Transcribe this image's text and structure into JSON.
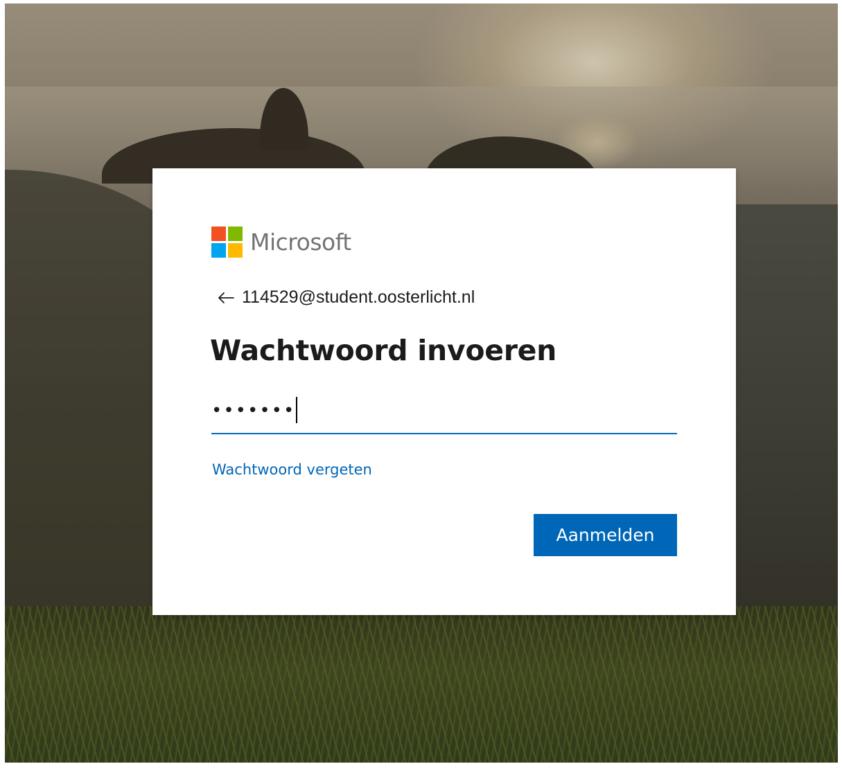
{
  "brand": {
    "name": "Microsoft",
    "logo_colors": [
      "#f25022",
      "#7fba00",
      "#00a4ef",
      "#ffb900"
    ]
  },
  "identity": {
    "email": "114529@student.oosterlicht.nl"
  },
  "form": {
    "title": "Wachtwoord invoeren",
    "password_value": "•••••••",
    "forgot_link": "Wachtwoord vergeten",
    "submit_label": "Aanmelden"
  },
  "colors": {
    "accent": "#0067b8",
    "text": "#1b1b1b"
  }
}
